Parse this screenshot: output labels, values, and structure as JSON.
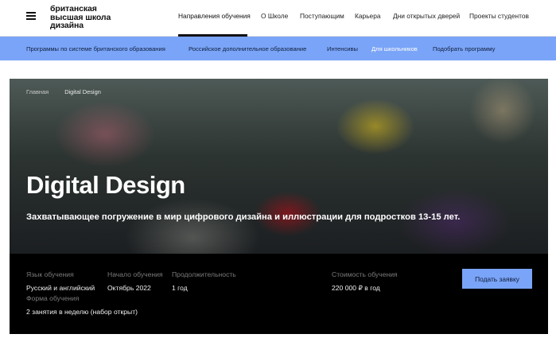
{
  "logo": {
    "line1": "британская",
    "line2": "высшая школа",
    "line3": "дизайна"
  },
  "nav": {
    "items": [
      {
        "label": "Направления обучения"
      },
      {
        "label": "О Школе"
      },
      {
        "label": "Поступающим"
      },
      {
        "label": "Карьера"
      },
      {
        "label": "Дни открытых дверей"
      },
      {
        "label": "Проекты студентов"
      }
    ]
  },
  "subnav": {
    "items": [
      {
        "label": "Программы по системе британского образования"
      },
      {
        "label": "Российское дополнительное образование"
      },
      {
        "label": "Интенсивы"
      },
      {
        "label": "Для школьников"
      },
      {
        "label": "Подобрать программу"
      }
    ]
  },
  "breadcrumb": {
    "home": "Главная",
    "current": "Digital Design"
  },
  "hero": {
    "title": "Digital Design",
    "lead": "Захватывающее погружение в мир цифрового дизайна и иллюстрации для подростков 13-15 лет."
  },
  "info": {
    "language_label": "Язык обучения",
    "language_value": "Русский и английский",
    "start_label": "Начало обучения",
    "start_value": "Октябрь 2022",
    "duration_label": "Продолжительность",
    "duration_value": "1 год",
    "format_label": "Форма обучения",
    "format_value": "2 занятия в неделю (набор открыт)",
    "price_label": "Стоимость обучения",
    "price_value": "220 000 ₽ в год",
    "cta": "Подать заявку"
  },
  "colors": {
    "accent": "#7aa4f7",
    "info_bg": "#000000"
  }
}
